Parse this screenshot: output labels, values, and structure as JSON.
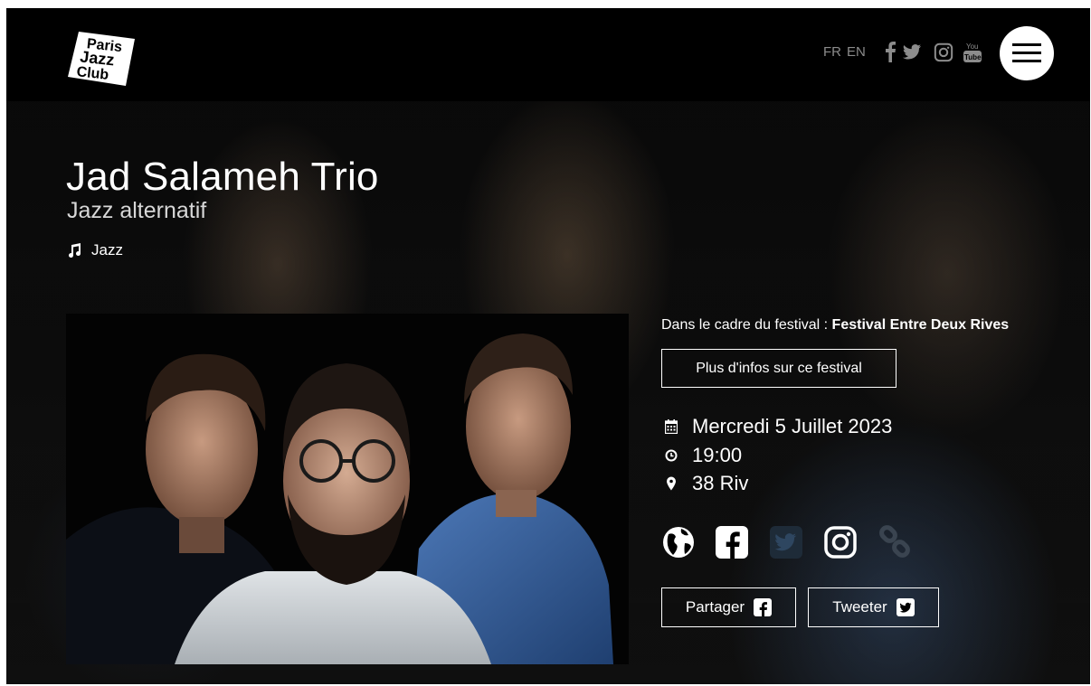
{
  "header": {
    "logo_text": [
      "Paris",
      "Jazz",
      "Club"
    ],
    "languages": [
      "FR",
      "EN"
    ],
    "social_icons": [
      "facebook-icon",
      "twitter-icon",
      "instagram-icon",
      "youtube-icon"
    ],
    "youtube_text": [
      "You",
      "Tube"
    ],
    "menu_icon": "hamburger-icon"
  },
  "event": {
    "title": "Jad Salameh Trio",
    "subtitle": "Jazz alternatif",
    "genre": "Jazz",
    "genre_icon": "music-note-icon"
  },
  "festival": {
    "prefix": "Dans le cadre du festival : ",
    "name": "Festival Entre Deux Rives",
    "more_info_label": "Plus d'infos sur ce festival"
  },
  "details": {
    "date": "Mercredi 5 Juillet 2023",
    "time": "19:00",
    "place": "38 Riv",
    "icons": [
      "calendar-icon",
      "clock-icon",
      "map-pin-icon"
    ]
  },
  "artist_links": [
    "globe-icon",
    "facebook-icon",
    "twitter-icon",
    "instagram-icon",
    "link-icon"
  ],
  "share": {
    "facebook_label": "Partager",
    "twitter_label": "Tweeter"
  },
  "colors": {
    "background": "#000000",
    "text": "#ffffff",
    "muted_text": "#8c8c8c",
    "disabled_icon": "#2b3a4a"
  }
}
